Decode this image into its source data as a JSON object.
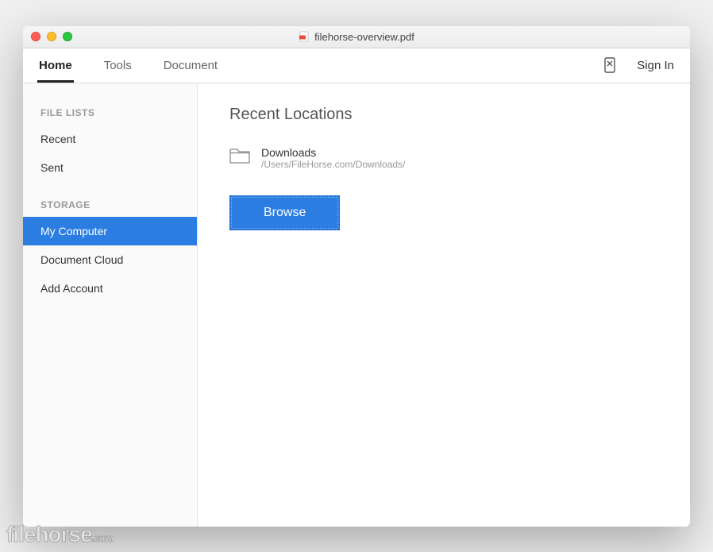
{
  "window": {
    "title": "filehorse-overview.pdf"
  },
  "toolbar": {
    "tabs": [
      {
        "label": "Home",
        "active": true
      },
      {
        "label": "Tools",
        "active": false
      },
      {
        "label": "Document",
        "active": false
      }
    ],
    "signIn": "Sign In"
  },
  "sidebar": {
    "sections": [
      {
        "header": "FILE LISTS",
        "items": [
          {
            "label": "Recent",
            "selected": false
          },
          {
            "label": "Sent",
            "selected": false
          }
        ]
      },
      {
        "header": "STORAGE",
        "items": [
          {
            "label": "My Computer",
            "selected": true
          },
          {
            "label": "Document Cloud",
            "selected": false
          },
          {
            "label": "Add Account",
            "selected": false
          }
        ]
      }
    ]
  },
  "main": {
    "heading": "Recent Locations",
    "locations": [
      {
        "name": "Downloads",
        "path": "/Users/FileHorse.com/Downloads/"
      }
    ],
    "browseLabel": "Browse"
  },
  "watermark": {
    "brand": "filehorse",
    "suffix": ".com"
  }
}
